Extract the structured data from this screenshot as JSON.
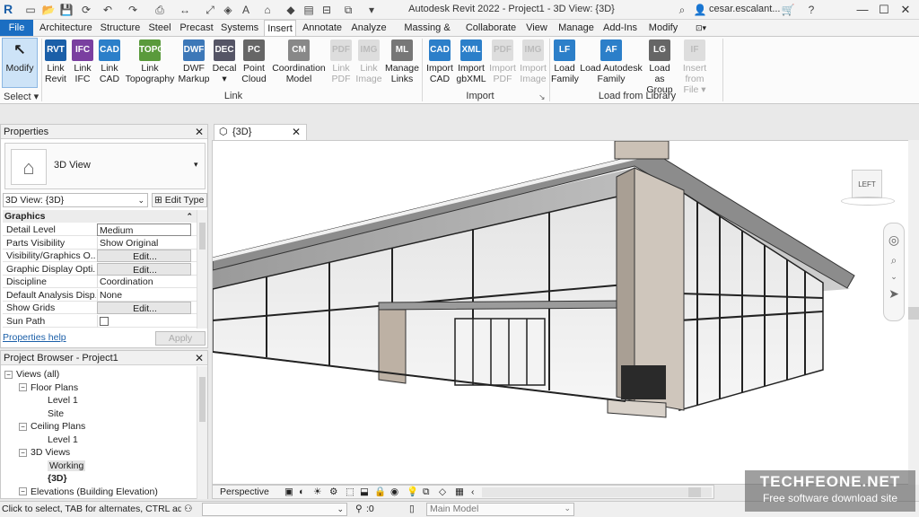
{
  "titlebar": {
    "title": "Autodesk Revit 2022 - Project1 - 3D View: {3D}",
    "user": "cesar.escalant...",
    "search_icon": "search-icon",
    "minimize": "—",
    "maximize": "☐",
    "close": "✕"
  },
  "tabs": [
    "File",
    "Architecture",
    "Structure",
    "Steel",
    "Precast",
    "Systems",
    "Insert",
    "Annotate",
    "Analyze",
    "Massing & Site",
    "Collaborate",
    "View",
    "Manage",
    "Add-Ins",
    "Modify"
  ],
  "ribbon": {
    "modify": "Modify",
    "select": "Select ▾",
    "link_buttons": [
      {
        "line1": "Link",
        "line2": "Revit",
        "icon": "RVT",
        "color": "#1b5fa8",
        "enabled": true
      },
      {
        "line1": "Link",
        "line2": "IFC",
        "icon": "IFC",
        "color": "#7a3fa0",
        "enabled": true
      },
      {
        "line1": "Link",
        "line2": "CAD",
        "icon": "CAD",
        "color": "#2c7fc9",
        "enabled": true
      },
      {
        "line1": "Link",
        "line2": "Topography",
        "icon": "TOPO",
        "color": "#5a9a3c",
        "enabled": true
      },
      {
        "line1": "DWF",
        "line2": "Markup",
        "icon": "DWF",
        "color": "#3d78b8",
        "enabled": true
      },
      {
        "line1": "Decal",
        "line2": "▾",
        "icon": "DEC",
        "color": "#556",
        "enabled": true
      },
      {
        "line1": "Point",
        "line2": "Cloud",
        "icon": "PC",
        "color": "#666",
        "enabled": true
      },
      {
        "line1": "Coordination",
        "line2": "Model",
        "icon": "CM",
        "color": "#888",
        "enabled": true
      },
      {
        "line1": "Link",
        "line2": "PDF",
        "icon": "PDF",
        "color": "#ccc",
        "enabled": false
      },
      {
        "line1": "Link",
        "line2": "Image",
        "icon": "IMG",
        "color": "#ccc",
        "enabled": false
      },
      {
        "line1": "Manage",
        "line2": "Links",
        "icon": "ML",
        "color": "#777",
        "enabled": true
      }
    ],
    "link_label": "Link",
    "import_buttons": [
      {
        "line1": "Import",
        "line2": "CAD",
        "icon": "CAD",
        "color": "#2c7fc9",
        "enabled": true
      },
      {
        "line1": "Import",
        "line2": "gbXML",
        "icon": "XML",
        "color": "#2c7fc9",
        "enabled": true
      },
      {
        "line1": "Import",
        "line2": "PDF",
        "icon": "PDF",
        "color": "#ccc",
        "enabled": false
      },
      {
        "line1": "Import",
        "line2": "Image",
        "icon": "IMG",
        "color": "#ccc",
        "enabled": false
      }
    ],
    "import_label": "Import",
    "library_buttons": [
      {
        "line1": "Load",
        "line2": "Family",
        "icon": "LF",
        "color": "#2c7fc9",
        "enabled": true
      },
      {
        "line1": "Load Autodesk",
        "line2": "Family",
        "icon": "AF",
        "color": "#2c7fc9",
        "enabled": true
      },
      {
        "line1": "Load as",
        "line2": "Group",
        "icon": "LG",
        "color": "#666",
        "enabled": true
      },
      {
        "line1": "Insert",
        "line2": "from File ▾",
        "icon": "IF",
        "color": "#ccc",
        "enabled": false
      }
    ],
    "library_label": "Load from Library"
  },
  "properties": {
    "title": "Properties",
    "type_name": "3D View",
    "instance": "3D View: {3D}",
    "edit_type": "Edit Type",
    "group": "Graphics",
    "rows": [
      {
        "key": "Detail Level",
        "value": "Medium",
        "button": false
      },
      {
        "key": "Parts Visibility",
        "value": "Show Original",
        "button": false
      },
      {
        "key": "Visibility/Graphics O...",
        "value": "Edit...",
        "button": true
      },
      {
        "key": "Graphic Display Opti...",
        "value": "Edit...",
        "button": true
      },
      {
        "key": "Discipline",
        "value": "Coordination",
        "button": false
      },
      {
        "key": "Default Analysis Disp...",
        "value": "None",
        "button": false
      },
      {
        "key": "Show Grids",
        "value": "Edit...",
        "button": true
      },
      {
        "key": "Sun Path",
        "value": "",
        "button": false
      }
    ],
    "help": "Properties help",
    "apply": "Apply"
  },
  "browser": {
    "title": "Project Browser - Project1",
    "nodes": [
      {
        "label": "Views (all)",
        "level": 0,
        "exp": "−"
      },
      {
        "label": "Floor Plans",
        "level": 1,
        "exp": "−"
      },
      {
        "label": "Level 1",
        "level": 2,
        "exp": ""
      },
      {
        "label": "Site",
        "level": 2,
        "exp": ""
      },
      {
        "label": "Ceiling Plans",
        "level": 1,
        "exp": "−"
      },
      {
        "label": "Level 1",
        "level": 2,
        "exp": ""
      },
      {
        "label": "3D Views",
        "level": 1,
        "exp": "−"
      },
      {
        "label": "Working",
        "level": 2,
        "exp": ""
      },
      {
        "label": "{3D}",
        "level": 2,
        "exp": ""
      },
      {
        "label": "Elevations (Building Elevation)",
        "level": 1,
        "exp": "−"
      }
    ]
  },
  "view": {
    "tab_label": "{3D}",
    "viewcube_label": "LEFT",
    "perspective": "Perspective"
  },
  "status": {
    "hint": "Click to select, TAB for alternates, CTRL adds, Sh",
    "count": ":0",
    "model": "Main Model"
  },
  "watermark": {
    "line1": "TECHFEONE.NET",
    "line2": "Free software download site"
  }
}
